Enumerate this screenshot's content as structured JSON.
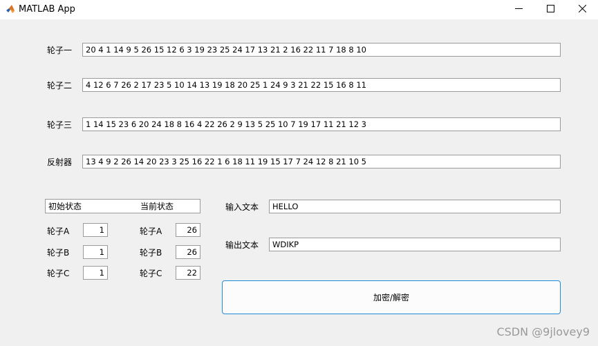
{
  "window": {
    "title": "MATLAB App",
    "icon": "matlab-icon",
    "controls": {
      "minimize": "minimize-icon",
      "maximize": "maximize-icon",
      "close": "close-icon"
    }
  },
  "rotors": {
    "rotor1": {
      "label": "轮子一",
      "value": "20 4 1 14 9 5 26 15 12 6 3 19 23 25 24 17 13 21 2 16 22 11 7 18 8 10"
    },
    "rotor2": {
      "label": "轮子二",
      "value": "4 12 6 7 26 2 17 23 5 10 14 13 19 18 20 25 1 24 9 3 21 22 15 16 8 11"
    },
    "rotor3": {
      "label": "轮子三",
      "value": "1 14 15 23 6 20 24 18 8 16 4 22 26 2 9 13 5 25 10 7 19 17 11 21 12 3"
    },
    "reflector": {
      "label": "反射器",
      "value": "13 4 9 2 26 14 20 23 3 25 16 22 1 6 18 11 19 15 17 7 24 12 8 21 10 5"
    }
  },
  "state": {
    "initial_header": "初始状态",
    "current_header": "当前状态",
    "initial": {
      "a": {
        "label": "轮子A",
        "value": "1"
      },
      "b": {
        "label": "轮子B",
        "value": "1"
      },
      "c": {
        "label": "轮子C",
        "value": "1"
      }
    },
    "current": {
      "a": {
        "label": "轮子A",
        "value": "26"
      },
      "b": {
        "label": "轮子B",
        "value": "26"
      },
      "c": {
        "label": "轮子C",
        "value": "22"
      }
    }
  },
  "io": {
    "input_label": "输入文本",
    "input_value": "HELLO",
    "output_label": "输出文本",
    "output_value": "WDIKP"
  },
  "action": {
    "label": "加密/解密"
  },
  "watermark": "CSDN @9jlovey9",
  "colors": {
    "background": "#f0f0f0",
    "button_border": "#1f8ad8",
    "field_border": "#9a9a9a"
  }
}
